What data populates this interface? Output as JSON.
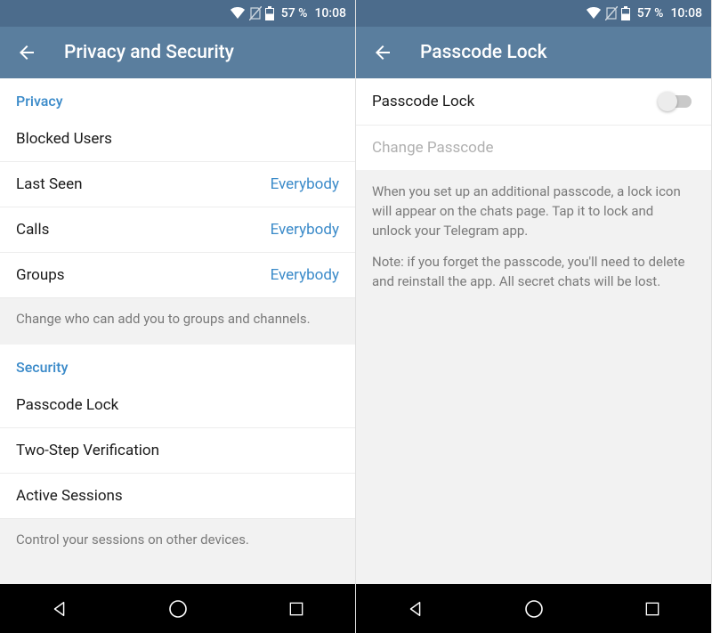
{
  "status": {
    "battery_pct": "57 %",
    "time": "10:08"
  },
  "left": {
    "title": "Privacy and Security",
    "privacy_header": "Privacy",
    "blocked_users": "Blocked Users",
    "last_seen_label": "Last Seen",
    "last_seen_value": "Everybody",
    "calls_label": "Calls",
    "calls_value": "Everybody",
    "groups_label": "Groups",
    "groups_value": "Everybody",
    "groups_note": "Change who can add you to groups and channels.",
    "security_header": "Security",
    "passcode_lock": "Passcode Lock",
    "two_step": "Two-Step Verification",
    "active_sessions": "Active Sessions",
    "sessions_note": "Control your sessions on other devices."
  },
  "right": {
    "title": "Passcode Lock",
    "passcode_toggle_label": "Passcode Lock",
    "change_passcode": "Change Passcode",
    "explainer_1": "When you set up an additional passcode, a lock icon will appear on the chats page. Tap it to lock and unlock your Telegram app.",
    "explainer_2": "Note: if you forget the passcode, you'll need to delete and reinstall the app. All secret chats will be lost."
  }
}
